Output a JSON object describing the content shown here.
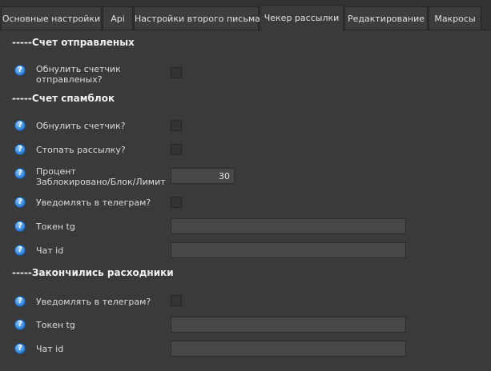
{
  "tabs": [
    {
      "label": "Основные настройки",
      "active": false
    },
    {
      "label": "Api",
      "active": false
    },
    {
      "label": "Настройки второго письма",
      "active": false
    },
    {
      "label": "Чекер рассылки",
      "active": true
    },
    {
      "label": "Редактирование",
      "active": false
    },
    {
      "label": "Макросы",
      "active": false
    }
  ],
  "help_icon_glyph": "?",
  "sections": {
    "sent": {
      "title": "-----Счет отправленых",
      "reset_label": "Обнулить счетчик\nотправленых?",
      "reset_checked": false
    },
    "spamblock": {
      "title": "-----Счет спамблок",
      "reset_label": "Обнулить счетчик?",
      "reset_checked": false,
      "stop_label": "Стопать рассылку?",
      "stop_checked": false,
      "percent_label": "Процент\nЗаблокировано/Блок/Лимит",
      "percent_value": "30",
      "notify_label": "Уведомлять в телеграм?",
      "notify_checked": false,
      "token_label": "Токен tg",
      "token_value": "",
      "chat_label": "Чат id",
      "chat_value": ""
    },
    "consumables": {
      "title": "-----Закончились расходники",
      "notify_label": "Уведомлять в телеграм?",
      "notify_checked": false,
      "token_label": "Токен tg",
      "token_value": "",
      "chat_label": "Чат id",
      "chat_value": ""
    }
  },
  "colors": {
    "background": "#3a3a3a",
    "tab_background": "#3d3d3d",
    "input_background": "#474747",
    "help_icon": "#3c8fe0"
  }
}
